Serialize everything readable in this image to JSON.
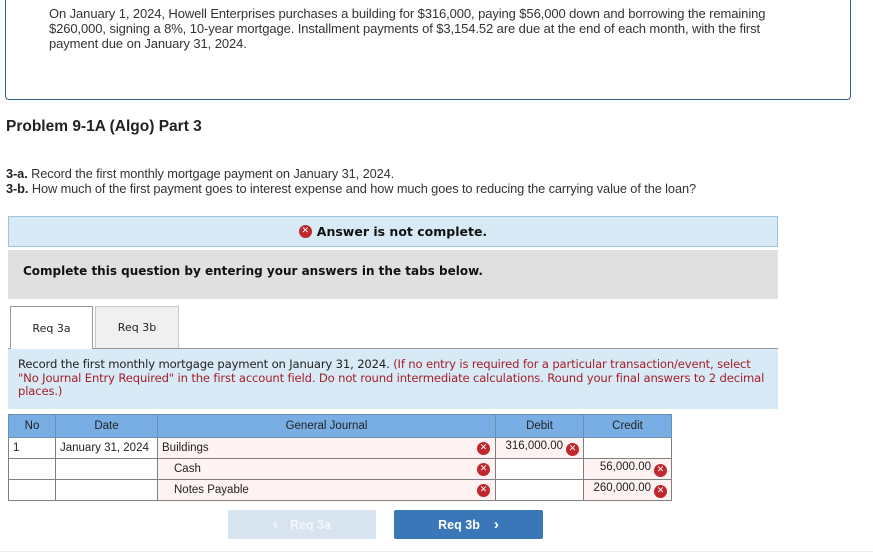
{
  "intro": {
    "text": "On January 1, 2024, Howell Enterprises purchases a building for $316,000, paying $56,000 down and borrowing the remaining $260,000, signing a 8%, 10-year mortgage. Installment payments of $3,154.52 are due at the end of each month, with the first payment due on January 31, 2024."
  },
  "problem": {
    "title": "Problem 9-1A (Algo) Part 3",
    "req_a_label": "3-a.",
    "req_a_text": " Record the first monthly mortgage payment on January 31, 2024.",
    "req_b_label": "3-b.",
    "req_b_text": " How much of the first payment goes to interest expense and how much goes to reducing the carrying value of the loan?"
  },
  "status": {
    "banner": "Answer is not complete.",
    "icon": "error-x-icon",
    "complete_prompt": "Complete this question by entering your answers in the tabs below."
  },
  "tabs": [
    {
      "label": "Req 3a",
      "active": true
    },
    {
      "label": "Req 3b",
      "active": false
    }
  ],
  "instructions": {
    "main": "Record the first monthly mortgage payment on January 31, 2024. ",
    "note": "(If no entry is required for a particular transaction/event, select \"No Journal Entry Required\" in the first account field. Do not round intermediate calculations. Round your final answers to 2 decimal places.)"
  },
  "journal": {
    "headers": {
      "no": "No",
      "date": "Date",
      "general_journal": "General Journal",
      "debit": "Debit",
      "credit": "Credit"
    },
    "rows": [
      {
        "no": "1",
        "date": "January 31, 2024",
        "account": "Buildings",
        "debit": "316,000.00",
        "credit": "",
        "account_incorrect": true,
        "debit_incorrect": true,
        "credit_incorrect": false
      },
      {
        "no": "",
        "date": "",
        "account": "Cash",
        "debit": "",
        "credit": "56,000.00",
        "account_incorrect": true,
        "debit_incorrect": false,
        "credit_incorrect": true
      },
      {
        "no": "",
        "date": "",
        "account": "Notes Payable",
        "debit": "",
        "credit": "260,000.00",
        "account_incorrect": true,
        "debit_incorrect": false,
        "credit_incorrect": true
      }
    ]
  },
  "navigation": {
    "prev_label": "Req 3a",
    "next_label": "Req 3b",
    "prev_icon": "‹",
    "next_icon": "›"
  },
  "colors": {
    "error_red": "#c0282d",
    "banner_blue": "#d9eaf7",
    "header_blue": "#78aee3",
    "button_blue": "#3a77b8",
    "note_red": "#a3202a"
  }
}
